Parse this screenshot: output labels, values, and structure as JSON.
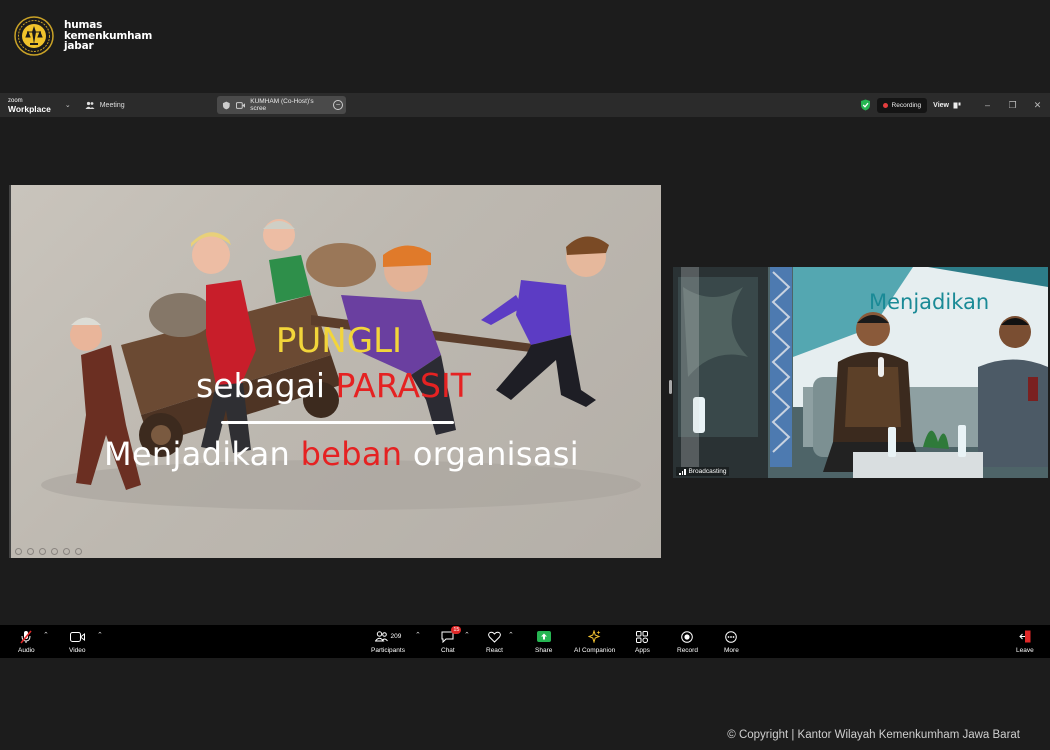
{
  "watermark": {
    "line1": "humas",
    "line2": "kemenkumham",
    "line3": "jabar"
  },
  "titlebar": {
    "brand_top": "zoom",
    "brand_bottom": "Workplace",
    "meeting_label": "Meeting",
    "share_label": "KUMHAM (Co-Host)'s scree",
    "recording_label": "Recording",
    "view_label": "View"
  },
  "slide": {
    "line1": "PUNGLI",
    "line2_white": "sebagai",
    "line2_red": "PARASIT",
    "line3_a": "Menjadikan",
    "line3_red": "beban",
    "line3_b": "organisasi"
  },
  "video": {
    "backdrop_text": "Menjadikan",
    "status_label": "Broadcasting"
  },
  "toolbar": {
    "audio": "Audio",
    "video": "Video",
    "participants": "Participants",
    "participants_count": "209",
    "chat": "Chat",
    "chat_badge": "15",
    "react": "React",
    "share": "Share",
    "ai_companion": "AI Companion",
    "apps": "Apps",
    "record": "Record",
    "more": "More",
    "leave": "Leave"
  },
  "footer": {
    "copyright": "© Copyright | Kantor Wilayah Kemenkumham Jawa Barat"
  },
  "colors": {
    "slide_yellow": "#f2d53a",
    "slide_red": "#e52222",
    "record_dot": "#e43e3e",
    "share_green": "#26b552"
  }
}
